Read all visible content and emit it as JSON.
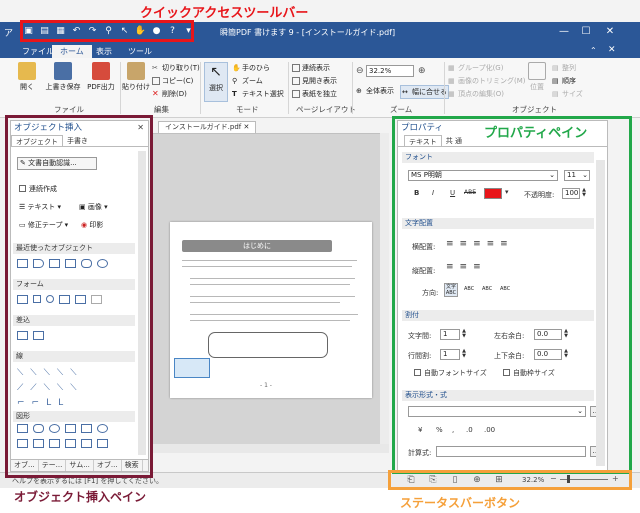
{
  "annotations": {
    "quick_access_toolbar": "クイックアクセスツールバー",
    "property_pane": "プロパティペイン",
    "object_insert_pane": "オブジェクト挿入ペイン",
    "status_bar_buttons": "ステータスバーボタン",
    "colors": {
      "red": "#e8151a",
      "green": "#22a84a",
      "maroon": "#7a1a36",
      "orange": "#f5a03a"
    }
  },
  "window": {
    "title": "瞬簡PDF 書けます 9 - [インストールガイド.pdf]",
    "app_icon_text": "ア"
  },
  "menu": [
    "ファイル",
    "ホーム",
    "表示",
    "ツール"
  ],
  "ribbon": {
    "file_group": {
      "label": "ファイル",
      "open": "開く",
      "save_as": "上書き保存",
      "pdf_out": "PDF出力"
    },
    "edit_group": {
      "label": "編集",
      "paste": "貼り付け",
      "cut": "切り取り(T)",
      "copy": "コピー(C)",
      "delete": "削除(D)"
    },
    "mode_group": {
      "label": "モード",
      "select": "選択",
      "hand": "手のひら",
      "zoom": "ズーム",
      "text_select": "テキスト選択"
    },
    "layout_group": {
      "label": "ページレイアウト",
      "continuous": "連続表示",
      "spread": "見開き表示",
      "cover": "表紙を独立"
    },
    "zoom_group": {
      "label": "ズーム",
      "zoom_value": "32.2%",
      "fit_all": "全体表示",
      "fit_width": "幅に合せる"
    },
    "object_group": {
      "label": "オブジェクト",
      "group": "グループ化(G)",
      "trim": "画像のトリミング(M)",
      "vertex": "頂点の編集(O)",
      "position": "位置",
      "align": "整列",
      "order": "順序",
      "size": "サイズ"
    }
  },
  "left_pane": {
    "title": "オブジェクト挿入",
    "tabs": [
      "オブジェクト",
      "手書き"
    ],
    "auto_ocr": "文書自動認識...",
    "continuous": "連続作成",
    "text": "テキスト",
    "image": "画像",
    "correction_tape": "修正テープ",
    "stamp": "印影",
    "recent": "最近使ったオブジェクト",
    "form": "フォーム",
    "fill": "差込",
    "line": "線",
    "figure": "図形",
    "bottom_tabs": [
      "オブ...",
      "テー...",
      "サム...",
      "オブ...",
      "検索"
    ]
  },
  "document": {
    "tab": "インストールガイド.pdf",
    "banner": "はじめに",
    "page_number": "- 1 -"
  },
  "right_pane": {
    "title": "プロパティ",
    "tabs": [
      "テキスト",
      "共 通"
    ],
    "font_section": "フォント",
    "font_name": "MS P明朝",
    "font_size": "11",
    "bold": "B",
    "italic": "I",
    "underline": "U",
    "strike": "ABE",
    "opacity_label": "不透明度:",
    "opacity_value": "100",
    "text_color": "#e8151a",
    "layout_section": "文字配置",
    "h_align": "横配置:",
    "v_align": "縦配置:",
    "direction": "方向:",
    "dir_opts": [
      "文字\nABC",
      "ABC",
      "ABC",
      "ABC"
    ],
    "spacing_section": "割付",
    "char_spacing": "文字間:",
    "char_spacing_val": "1",
    "line_spacing": "行間割:",
    "line_spacing_val": "1",
    "lr_margin": "左右余白:",
    "lr_margin_val": "0.0",
    "tb_margin": "上下余白:",
    "tb_margin_val": "0.0",
    "auto_font_size": "自動フォントサイズ",
    "auto_size": "自動枠サイズ",
    "format_section": "表示形式・式",
    "format_buttons": [
      "¥",
      "%",
      ",",
      ".0",
      ".00"
    ],
    "calc_label": "計算式:"
  },
  "status_bar": {
    "hint": "ヘルプを表示するには [F1] を押してください。",
    "zoom": "32.2%"
  }
}
